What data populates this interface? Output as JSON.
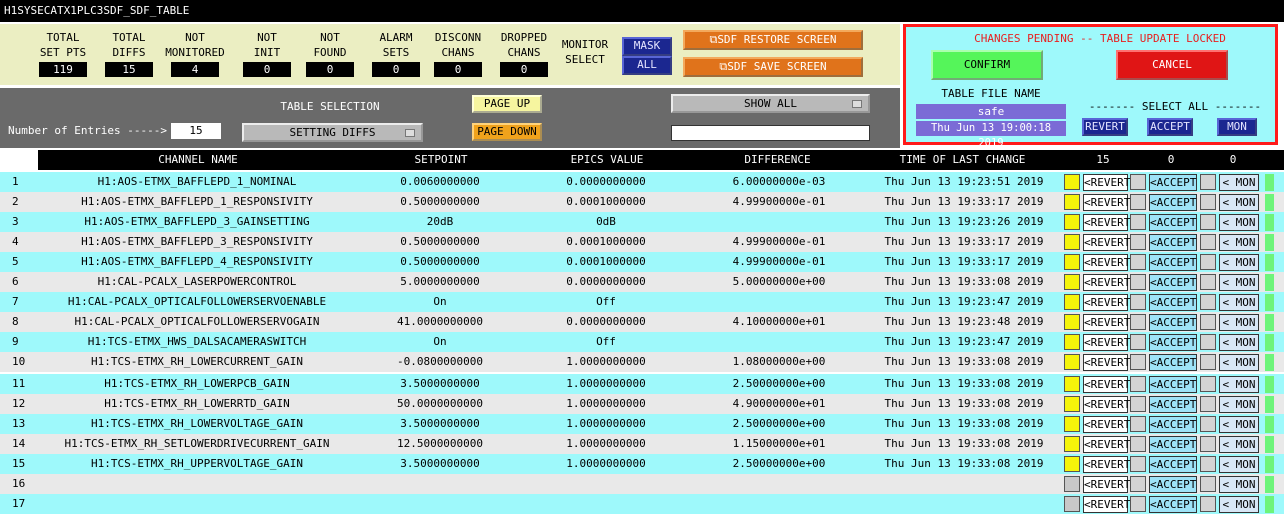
{
  "window": {
    "title": "H1SYSECATX1PLC3SDF_SDF_TABLE"
  },
  "counts": [
    {
      "label1": "TOTAL",
      "label2": "SET PTS",
      "value": "119"
    },
    {
      "label1": "TOTAL",
      "label2": "DIFFS",
      "value": "15"
    },
    {
      "label1": "NOT",
      "label2": "MONITORED",
      "value": "4"
    },
    {
      "label1": "NOT",
      "label2": "INIT",
      "value": "0"
    },
    {
      "label1": "NOT",
      "label2": "FOUND",
      "value": "0"
    },
    {
      "label1": "ALARM",
      "label2": "SETS",
      "value": "0"
    },
    {
      "label1": "DISCONN",
      "label2": "CHANS",
      "value": "0"
    },
    {
      "label1": "DROPPED",
      "label2": "CHANS",
      "value": "0"
    }
  ],
  "monitor_select": {
    "label1": "MONITOR",
    "label2": "SELECT",
    "mask": "MASK",
    "all": "ALL"
  },
  "sdf": {
    "restore": "SDF RESTORE SCREEN",
    "save": "SDF SAVE SCREEN"
  },
  "table_select": {
    "label": "TABLE SELECTION",
    "page_up": "PAGE UP",
    "page_down": "PAGE DOWN",
    "show_all": "SHOW ALL",
    "entries_label": "Number of Entries ----->",
    "entries_value": "15",
    "setting_diffs": "SETTING DIFFS",
    "filter_value": ""
  },
  "pending": {
    "message": "CHANGES PENDING -- TABLE UPDATE LOCKED",
    "confirm": "CONFIRM",
    "cancel": "CANCEL",
    "file_label": "TABLE FILE NAME",
    "file_name": "safe",
    "file_time": "Thu Jun 13 19:00:18 2019",
    "select_all": "------- SELECT ALL -------",
    "revert": "REVERT",
    "accept": "ACCEPT",
    "mon": "MON"
  },
  "table": {
    "headers": {
      "channel": "CHANNEL NAME",
      "setpoint": "SETPOINT",
      "epics": "EPICS VALUE",
      "difference": "DIFFERENCE",
      "time": "TIME OF LAST CHANGE",
      "c1": "15",
      "c2": "0",
      "c3": "0"
    },
    "row_buttons": {
      "revert": "<REVERT",
      "accept": "<ACCEPT",
      "mon": "< MON"
    },
    "rows": [
      {
        "n": "1",
        "channel": "H1:AOS-ETMX_BAFFLEPD_1_NOMINAL",
        "setpoint": "0.0060000000",
        "epics": "0.0000000000",
        "diff": "6.00000000e-03",
        "time": "Thu Jun 13 19:23:51 2019"
      },
      {
        "n": "2",
        "channel": "H1:AOS-ETMX_BAFFLEPD_1_RESPONSIVITY",
        "setpoint": "0.5000000000",
        "epics": "0.0001000000",
        "diff": "4.99900000e-01",
        "time": "Thu Jun 13 19:33:17 2019"
      },
      {
        "n": "3",
        "channel": "H1:AOS-ETMX_BAFFLEPD_3_GAINSETTING",
        "setpoint": "20dB",
        "epics": "0dB",
        "diff": "",
        "time": "Thu Jun 13 19:23:26 2019"
      },
      {
        "n": "4",
        "channel": "H1:AOS-ETMX_BAFFLEPD_3_RESPONSIVITY",
        "setpoint": "0.5000000000",
        "epics": "0.0001000000",
        "diff": "4.99900000e-01",
        "time": "Thu Jun 13 19:33:17 2019"
      },
      {
        "n": "5",
        "channel": "H1:AOS-ETMX_BAFFLEPD_4_RESPONSIVITY",
        "setpoint": "0.5000000000",
        "epics": "0.0001000000",
        "diff": "4.99900000e-01",
        "time": "Thu Jun 13 19:33:17 2019"
      },
      {
        "n": "6",
        "channel": "H1:CAL-PCALX_LASERPOWERCONTROL",
        "setpoint": "5.0000000000",
        "epics": "0.0000000000",
        "diff": "5.00000000e+00",
        "time": "Thu Jun 13 19:33:08 2019"
      },
      {
        "n": "7",
        "channel": "H1:CAL-PCALX_OPTICALFOLLOWERSERVOENABLE",
        "setpoint": "On",
        "epics": "Off",
        "diff": "",
        "time": "Thu Jun 13 19:23:47 2019"
      },
      {
        "n": "8",
        "channel": "H1:CAL-PCALX_OPTICALFOLLOWERSERVOGAIN",
        "setpoint": "41.0000000000",
        "epics": "0.0000000000",
        "diff": "4.10000000e+01",
        "time": "Thu Jun 13 19:23:48 2019"
      },
      {
        "n": "9",
        "channel": "H1:TCS-ETMX_HWS_DALSACAMERASWITCH",
        "setpoint": "On",
        "epics": "Off",
        "diff": "",
        "time": "Thu Jun 13 19:23:47 2019"
      },
      {
        "n": "10",
        "channel": "H1:TCS-ETMX_RH_LOWERCURRENT_GAIN",
        "setpoint": "-0.0800000000",
        "epics": "1.0000000000",
        "diff": "1.08000000e+00",
        "time": "Thu Jun 13 19:33:08 2019"
      },
      {
        "n": "11",
        "channel": "H1:TCS-ETMX_RH_LOWERPCB_GAIN",
        "setpoint": "3.5000000000",
        "epics": "1.0000000000",
        "diff": "2.50000000e+00",
        "time": "Thu Jun 13 19:33:08 2019"
      },
      {
        "n": "12",
        "channel": "H1:TCS-ETMX_RH_LOWERRTD_GAIN",
        "setpoint": "50.0000000000",
        "epics": "1.0000000000",
        "diff": "4.90000000e+01",
        "time": "Thu Jun 13 19:33:08 2019"
      },
      {
        "n": "13",
        "channel": "H1:TCS-ETMX_RH_LOWERVOLTAGE_GAIN",
        "setpoint": "3.5000000000",
        "epics": "1.0000000000",
        "diff": "2.50000000e+00",
        "time": "Thu Jun 13 19:33:08 2019"
      },
      {
        "n": "14",
        "channel": "H1:TCS-ETMX_RH_SETLOWERDRIVECURRENT_GAIN",
        "setpoint": "12.5000000000",
        "epics": "1.0000000000",
        "diff": "1.15000000e+01",
        "time": "Thu Jun 13 19:33:08 2019"
      },
      {
        "n": "15",
        "channel": "H1:TCS-ETMX_RH_UPPERVOLTAGE_GAIN",
        "setpoint": "3.5000000000",
        "epics": "1.0000000000",
        "diff": "2.50000000e+00",
        "time": "Thu Jun 13 19:33:08 2019"
      },
      {
        "n": "16",
        "channel": "",
        "setpoint": "",
        "epics": "",
        "diff": "",
        "time": ""
      },
      {
        "n": "17",
        "channel": "",
        "setpoint": "",
        "epics": "",
        "diff": "",
        "time": ""
      }
    ]
  },
  "colors": {
    "row_cyan": "#9ef9fb",
    "row_gray": "#e9e9e9",
    "alert": "#ff1a1a",
    "check_yellow": "#f5f40a",
    "monitor_green": "#6ef47a"
  }
}
